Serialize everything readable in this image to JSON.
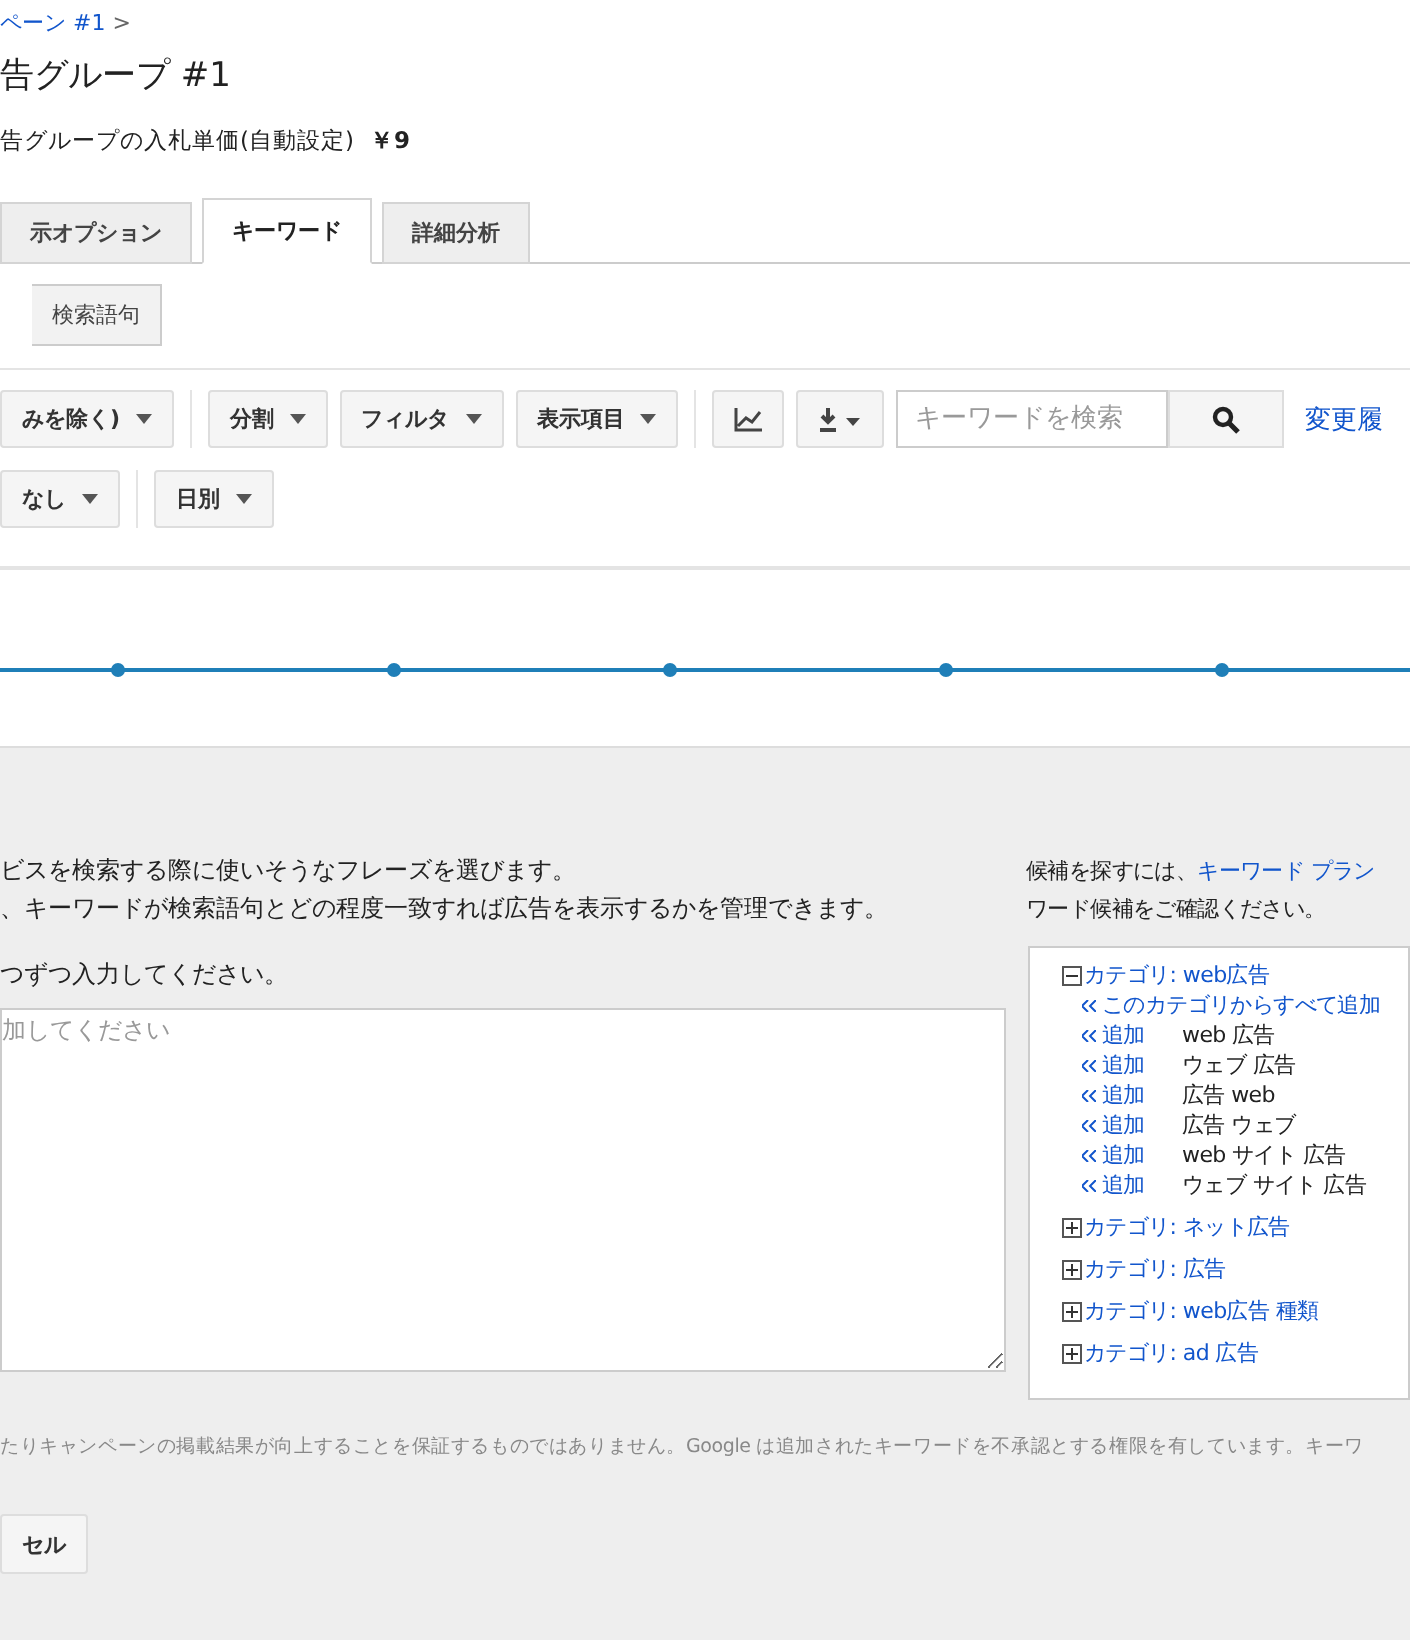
{
  "breadcrumb": {
    "link": "ペーン #1",
    "separator": ">"
  },
  "title": "告グループ #1",
  "bid": {
    "label": "告グループの入札単価(自動設定)",
    "value": "￥9"
  },
  "tabs": [
    {
      "label": "示オプション",
      "selected": false
    },
    {
      "label": "キーワード",
      "selected": true
    },
    {
      "label": "詳細分析",
      "selected": false
    }
  ],
  "subtabs": [
    {
      "label": "検索語句",
      "selected": false
    }
  ],
  "toolbar": [
    {
      "kind": "dropdown",
      "label": "みを除く)"
    },
    {
      "kind": "divider"
    },
    {
      "kind": "dropdown",
      "label": "分割"
    },
    {
      "kind": "dropdown",
      "label": "フィルタ"
    },
    {
      "kind": "dropdown",
      "label": "表示項目"
    },
    {
      "kind": "divider"
    },
    {
      "kind": "chart"
    },
    {
      "kind": "download"
    }
  ],
  "search": {
    "placeholder": "キーワードを検索"
  },
  "history_link": "変更履",
  "toolbar2": [
    {
      "kind": "dropdown",
      "label": "なし"
    },
    {
      "kind": "divider"
    },
    {
      "kind": "dropdown",
      "label": "日別"
    }
  ],
  "instructions": [
    "ビスを検索する際に使いそうなフレーズを選びます。",
    "、キーワードが検索語句とどの程度一致すれば広告を表示するかを管理できます。"
  ],
  "entry_prompt": "つずつ入力してください。",
  "keyword_box": {
    "placeholder": "加してください"
  },
  "suggest": {
    "text": "候補を探すには、",
    "link": "キーワード プラン",
    "line2": "ワード候補をご確認ください。"
  },
  "categories": [
    {
      "label": "カテゴリ: web広告",
      "expanded": true,
      "children": [
        {
          "kind": "all",
          "action": "このカテゴリからすべて追加"
        },
        {
          "kind": "add",
          "action": "追加",
          "keyword": "web 広告"
        },
        {
          "kind": "add",
          "action": "追加",
          "keyword": "ウェブ 広告"
        },
        {
          "kind": "add",
          "action": "追加",
          "keyword": "広告 web"
        },
        {
          "kind": "add",
          "action": "追加",
          "keyword": "広告 ウェブ"
        },
        {
          "kind": "add",
          "action": "追加",
          "keyword": "web サイト 広告"
        },
        {
          "kind": "add",
          "action": "追加",
          "keyword": "ウェブ サイト 広告"
        }
      ]
    },
    {
      "label": "カテゴリ: ネット広告",
      "expanded": false
    },
    {
      "label": "カテゴリ: 広告",
      "expanded": false
    },
    {
      "label": "カテゴリ: web広告 種類",
      "expanded": false
    },
    {
      "label": "カテゴリ: ad 広告",
      "expanded": false
    }
  ],
  "disclaimer": "たりキャンペーンの掲載結果が向上することを保証するものではありません。Google は追加されたキーワードを不承認とする権限を有しています。キーワ",
  "cancel_button": "セル"
}
